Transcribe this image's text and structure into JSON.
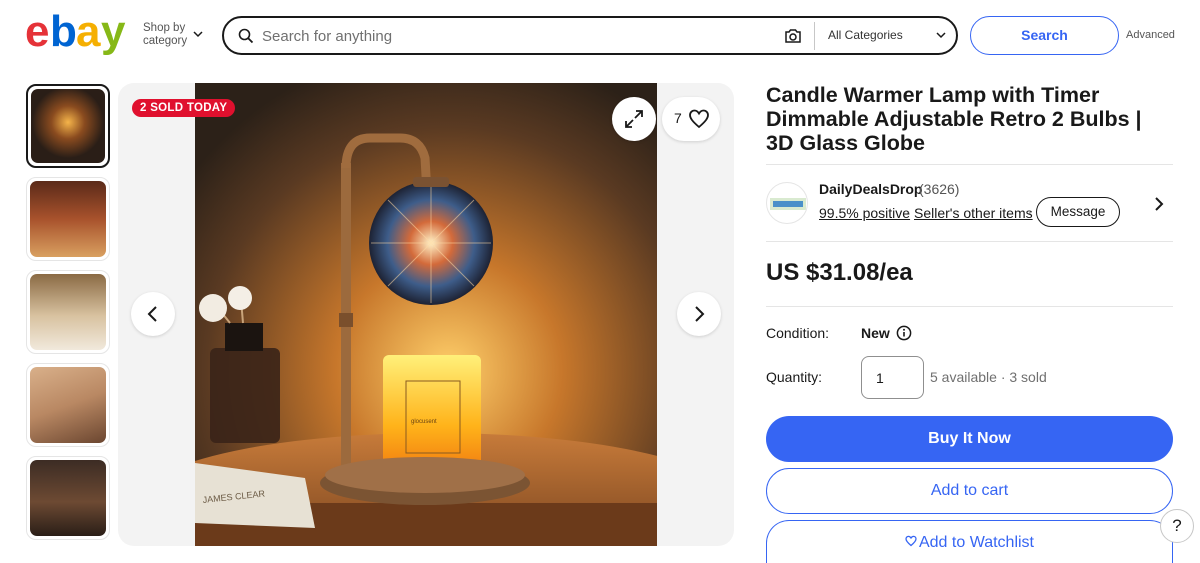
{
  "header": {
    "shop_by_line1": "Shop by",
    "shop_by_line2": "category",
    "search_placeholder": "Search for anything",
    "category_select": "All Categories",
    "search_button": "Search",
    "advanced_link": "Advanced",
    "logo_letters": [
      "e",
      "b",
      "a",
      "y"
    ],
    "logo_colors": [
      "#e53238",
      "#0064d2",
      "#f5af02",
      "#86b817"
    ]
  },
  "gallery": {
    "sold_badge": "2 SOLD TODAY",
    "watch_count": "7",
    "thumbnails": [
      {
        "name": "thumb-1",
        "color": "#2a1e17"
      },
      {
        "name": "thumb-2",
        "color": "#7a3b24"
      },
      {
        "name": "thumb-3",
        "color": "#c9a070"
      },
      {
        "name": "thumb-4",
        "color": "#b98863"
      },
      {
        "name": "thumb-5",
        "color": "#3c2c24"
      }
    ],
    "book_text": "JAMES CLEAR",
    "candle_text": "glocusent"
  },
  "product": {
    "title": "Candle Warmer Lamp with Timer Dimmable Adjustable Retro 2 Bulbs | 3D Glass Globe",
    "seller_name": "DailyDealsDrop",
    "seller_score": "(3626)",
    "seller_positive": "99.5% positive",
    "seller_other": "Seller's other items",
    "message_button": "Message",
    "price": "US $31.08/ea",
    "condition_label": "Condition:",
    "condition_value": "New",
    "quantity_label": "Quantity:",
    "quantity_value": "1",
    "availability": "5 available · 3 sold",
    "buy_now": "Buy It Now",
    "add_to_cart": "Add to cart",
    "add_to_watchlist": "Add to Watchlist"
  },
  "help_button": "?",
  "colors": {
    "accent_blue": "#3665f3",
    "sold_red": "#e0102e"
  }
}
